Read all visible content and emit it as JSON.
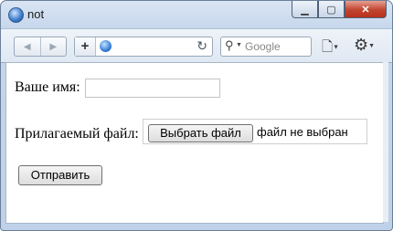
{
  "window": {
    "title": "not"
  },
  "toolbar": {
    "search_placeholder": "Google",
    "add_tab_label": "+"
  },
  "form": {
    "name_label": "Ваше имя:",
    "name_value": "",
    "file_label": "Прилагаемый файл:",
    "file_button": "Выбрать файл",
    "file_status": "файл не выбран",
    "submit_label": "Отправить"
  }
}
